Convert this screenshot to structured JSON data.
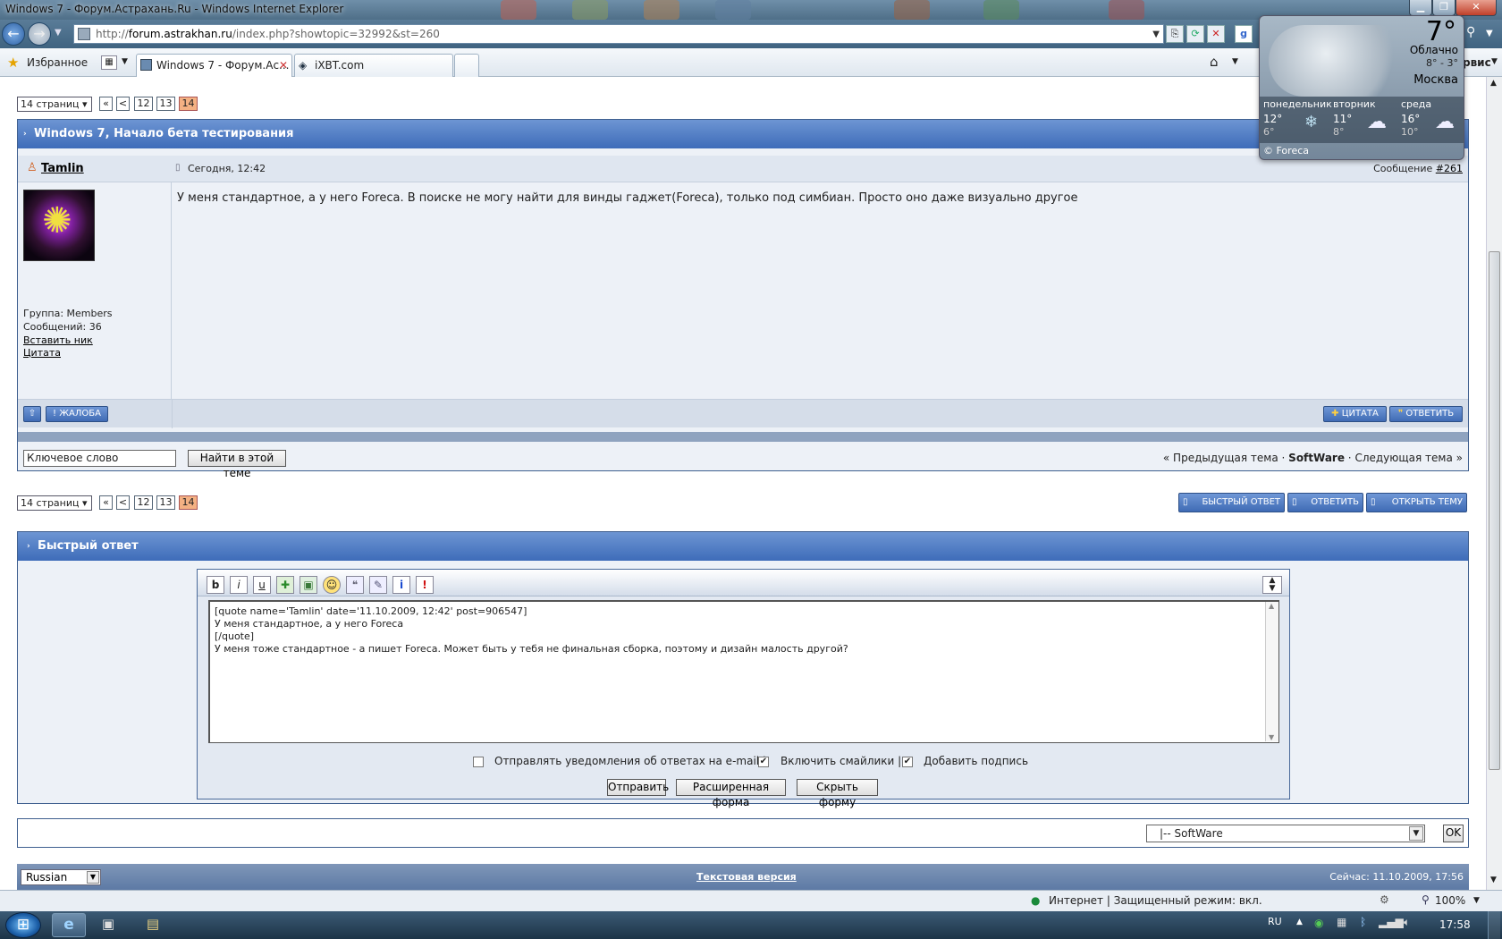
{
  "window": {
    "title": "Windows 7 - Форум.Астрахань.Ru - Windows Internet Explorer"
  },
  "browser": {
    "url_prefix": "http://",
    "url_host": "forum.astrakhan.ru",
    "url_path": "/index.php?showtopic=32992&st=260",
    "favorites": "Избранное",
    "tabs": [
      {
        "label": "Windows 7 - Форум.Ас..."
      },
      {
        "label": "iXBT.com"
      }
    ],
    "service_fragment": "рвис"
  },
  "weather": {
    "temperature": "7°",
    "condition": "Облачно",
    "range": "8° - 3°",
    "city": "Москва",
    "forecast": [
      {
        "day": "понедельник",
        "high": "12°",
        "low": "6°"
      },
      {
        "day": "вторник",
        "high": "11°",
        "low": "8°"
      },
      {
        "day": "среда",
        "high": "16°",
        "low": "10°"
      }
    ],
    "credit": "© Foreca"
  },
  "pager": {
    "pages_label": "14 страниц",
    "first": "«",
    "prev": "<",
    "pages": [
      "12",
      "13",
      "14"
    ]
  },
  "topic": {
    "title": "Windows 7, Начало бета тестирования",
    "post": {
      "author": "Tamlin",
      "date": "Сегодня, 12:42",
      "message_label": "Сообщение",
      "message_number": "#261",
      "text": "У меня стандартное, а у него Foreca. В поиске не могу найти для винды гаджет(Foreca), только под симбиан. Просто оно даже визуально другое",
      "group": "Группа: Members",
      "posts_count": "Сообщений: 36",
      "insert_nick": "Вставить ник",
      "quote_link": "Цитата",
      "up_button": "⇧",
      "report_button": "! ЖАЛОБА",
      "quote_button": "ЦИТАТА",
      "reply_button": "ОТВЕТИТЬ"
    },
    "search": {
      "value": "Ключевое слово",
      "button": "Найти в этой теме"
    },
    "nav": {
      "prev_topic": "« Предыдущая тема",
      "sep1": " · ",
      "forum": "SoftWare",
      "sep2": " · ",
      "next_topic": "Следующая тема »"
    }
  },
  "actions": {
    "fast_reply": "БЫСТРЫЙ ОТВЕТ",
    "reply": "ОТВЕТИТЬ",
    "new_topic": "ОТКРЫТЬ ТЕМУ"
  },
  "quick_reply": {
    "title": "Быстрый ответ",
    "text": "[quote name='Tamlin' date='11.10.2009, 12:42' post=906547]\nУ меня стандартное, а у него Foreca\n[/quote]\nУ меня тоже стандартное - а пишет Foreca. Может быть у тебя не финальная сборка, поэтому и дизайн малость другой?",
    "notify_label": "Отправлять уведомления об ответах на e-mail |",
    "smilies_label": "Включить смайлики |",
    "signature_label": "Добавить подпись",
    "submit": "Отправить",
    "advanced": "Расширенная форма",
    "hide": "Скрыть форму"
  },
  "jump": {
    "value": "|-- SoftWare",
    "ok": "OK"
  },
  "footer": {
    "language": "Russian",
    "text_version": "Текстовая версия",
    "now": "Сейчас: 11.10.2009, 17:56"
  },
  "status": {
    "zone": "Интернет | Защищенный режим: вкл.",
    "zoom": "100%"
  },
  "tray": {
    "lang": "RU",
    "time": "17:58"
  }
}
